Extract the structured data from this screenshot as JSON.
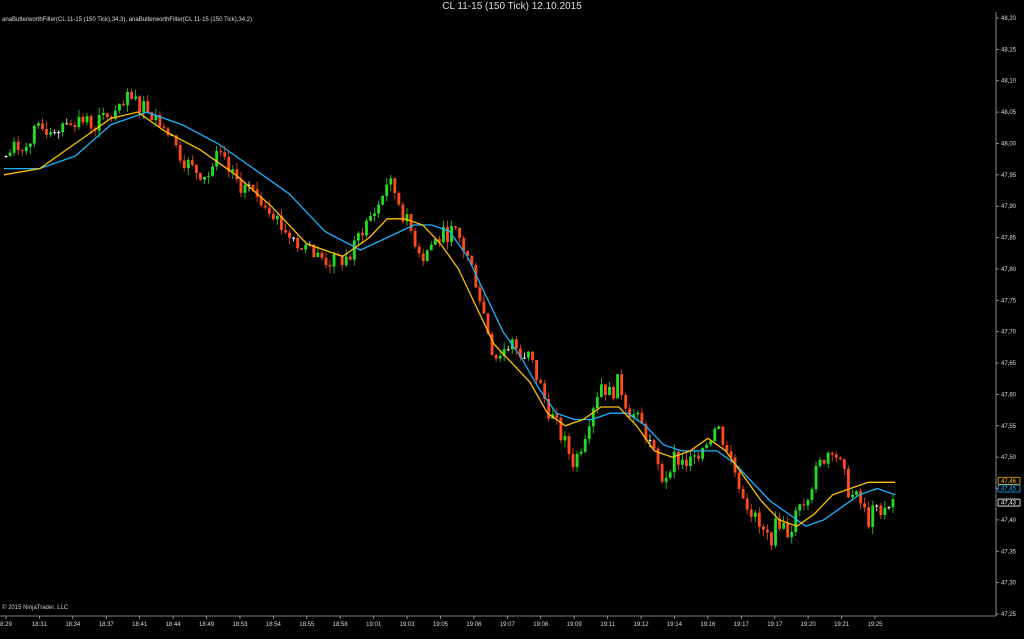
{
  "window": {
    "title": "CL 11-15 (150 Tick)  12.10.2015",
    "indicator_label": "anaButterworthFilter(CL 11-15 (150 Tick),34,3), anaButterworthFilter(CL 11-15 (150 Tick),34,2)",
    "copyright": "© 2015 NinjaTrader, LLC"
  },
  "colors": {
    "background": "#000000",
    "up_candle": "#22dd22",
    "down_candle": "#ff4a1a",
    "doji": "#ffffff",
    "filter_3pole": "#1ab2ff",
    "filter_2pole": "#ffc000",
    "axis": "#aaaaaa"
  },
  "chart_data": {
    "type": "candlestick",
    "ylim": [
      47.25,
      48.2
    ],
    "y_ticks": [
      "48,20",
      "48,15",
      "48,10",
      "48,05",
      "48,00",
      "47,95",
      "47,90",
      "47,85",
      "47,80",
      "47,75",
      "47,70",
      "47,65",
      "47,60",
      "47,55",
      "47,50",
      "47,45",
      "47,40",
      "47,35",
      "47,30",
      "47,25"
    ],
    "x_ticks": [
      "8:29",
      "18:31",
      "18:34",
      "18:37",
      "18:41",
      "18:44",
      "18:49",
      "18:53",
      "18:54",
      "18:55",
      "18:58",
      "19:01",
      "19:03",
      "19:05",
      "19:06",
      "19:07",
      "19:08",
      "19:09",
      "19:11",
      "19:12",
      "19:14",
      "19:16",
      "19:17",
      "19:17",
      "19:20",
      "19:21",
      "19:25"
    ],
    "price_badges": [
      {
        "label": "47,46",
        "value": 47.46,
        "color": "#ffc000"
      },
      {
        "label": "47,45",
        "value": 47.45,
        "color": "#1ab2ff"
      },
      {
        "label": "47,43",
        "value": 47.43,
        "color": "#ffffff"
      }
    ],
    "close_path": [
      [
        0,
        47.98
      ],
      [
        4,
        48.02
      ],
      [
        8,
        48.04
      ],
      [
        10,
        48.03
      ],
      [
        13,
        48.05
      ],
      [
        14,
        48.07
      ],
      [
        16,
        48.06
      ],
      [
        18,
        48.03
      ],
      [
        19,
        48.0
      ],
      [
        21,
        47.96
      ],
      [
        23,
        47.95
      ],
      [
        24,
        47.98
      ],
      [
        26,
        47.94
      ],
      [
        28,
        47.92
      ],
      [
        30,
        47.9
      ],
      [
        31,
        47.87
      ],
      [
        33,
        47.84
      ],
      [
        35,
        47.82
      ],
      [
        37,
        47.81
      ],
      [
        39,
        47.82
      ],
      [
        40,
        47.86
      ],
      [
        42,
        47.9
      ],
      [
        43,
        47.94
      ],
      [
        44,
        47.92
      ],
      [
        45,
        47.88
      ],
      [
        46,
        47.85
      ],
      [
        47,
        47.82
      ],
      [
        48,
        47.84
      ],
      [
        50,
        47.86
      ],
      [
        51,
        47.85
      ],
      [
        52,
        47.82
      ],
      [
        53,
        47.78
      ],
      [
        54,
        47.72
      ],
      [
        55,
        47.66
      ],
      [
        56,
        47.67
      ],
      [
        57,
        47.68
      ],
      [
        59,
        47.66
      ],
      [
        60,
        47.62
      ],
      [
        61,
        47.58
      ],
      [
        62,
        47.55
      ],
      [
        63,
        47.52
      ],
      [
        64,
        47.49
      ],
      [
        65,
        47.53
      ],
      [
        66,
        47.58
      ],
      [
        67,
        47.62
      ],
      [
        68,
        47.6
      ],
      [
        69,
        47.62
      ],
      [
        70,
        47.58
      ],
      [
        71,
        47.56
      ],
      [
        72,
        47.54
      ],
      [
        73,
        47.5
      ],
      [
        74,
        47.46
      ],
      [
        75,
        47.5
      ],
      [
        77,
        47.49
      ],
      [
        78,
        47.51
      ],
      [
        79,
        47.53
      ],
      [
        80,
        47.55
      ],
      [
        81,
        47.52
      ],
      [
        82,
        47.48
      ],
      [
        83,
        47.44
      ],
      [
        84,
        47.41
      ],
      [
        85,
        47.38
      ],
      [
        86,
        47.37
      ],
      [
        87,
        47.4
      ],
      [
        88,
        47.38
      ],
      [
        89,
        47.41
      ],
      [
        90,
        47.44
      ],
      [
        91,
        47.47
      ],
      [
        92,
        47.5
      ],
      [
        93,
        47.52
      ],
      [
        94,
        47.48
      ],
      [
        95,
        47.44
      ],
      [
        96,
        47.43
      ],
      [
        97,
        47.4
      ],
      [
        98,
        47.42
      ],
      [
        100,
        47.43
      ]
    ],
    "series": [
      {
        "name": "anaButterworthFilter(CL 11-15 (150 Tick),34,3)",
        "color": "#1ab2ff",
        "values": [
          [
            0,
            47.96
          ],
          [
            4,
            47.96
          ],
          [
            8,
            47.98
          ],
          [
            12,
            48.03
          ],
          [
            16,
            48.05
          ],
          [
            20,
            48.03
          ],
          [
            24,
            48.0
          ],
          [
            28,
            47.96
          ],
          [
            32,
            47.92
          ],
          [
            36,
            47.86
          ],
          [
            40,
            47.83
          ],
          [
            43,
            47.85
          ],
          [
            46,
            47.87
          ],
          [
            48,
            47.87
          ],
          [
            50,
            47.86
          ],
          [
            52,
            47.82
          ],
          [
            54,
            47.76
          ],
          [
            56,
            47.7
          ],
          [
            58,
            47.66
          ],
          [
            60,
            47.61
          ],
          [
            62,
            47.57
          ],
          [
            64,
            47.56
          ],
          [
            66,
            47.56
          ],
          [
            68,
            47.57
          ],
          [
            70,
            47.57
          ],
          [
            72,
            47.55
          ],
          [
            74,
            47.52
          ],
          [
            76,
            47.51
          ],
          [
            78,
            47.51
          ],
          [
            80,
            47.51
          ],
          [
            82,
            47.49
          ],
          [
            84,
            47.46
          ],
          [
            86,
            47.43
          ],
          [
            88,
            47.41
          ],
          [
            90,
            47.39
          ],
          [
            92,
            47.4
          ],
          [
            94,
            47.42
          ],
          [
            96,
            47.44
          ],
          [
            98,
            47.45
          ],
          [
            100,
            47.44
          ]
        ]
      },
      {
        "name": "anaButterworthFilter(CL 11-15 (150 Tick),34,2)",
        "color": "#ffc000",
        "values": [
          [
            0,
            47.95
          ],
          [
            4,
            47.96
          ],
          [
            8,
            48.0
          ],
          [
            12,
            48.04
          ],
          [
            15,
            48.05
          ],
          [
            18,
            48.02
          ],
          [
            22,
            47.99
          ],
          [
            26,
            47.95
          ],
          [
            30,
            47.9
          ],
          [
            34,
            47.84
          ],
          [
            38,
            47.82
          ],
          [
            41,
            47.85
          ],
          [
            43,
            47.88
          ],
          [
            45,
            47.88
          ],
          [
            47,
            47.87
          ],
          [
            49,
            47.84
          ],
          [
            51,
            47.8
          ],
          [
            53,
            47.74
          ],
          [
            55,
            47.68
          ],
          [
            57,
            47.65
          ],
          [
            59,
            47.62
          ],
          [
            61,
            47.57
          ],
          [
            63,
            47.55
          ],
          [
            65,
            47.56
          ],
          [
            67,
            47.58
          ],
          [
            69,
            47.58
          ],
          [
            71,
            47.55
          ],
          [
            73,
            47.51
          ],
          [
            75,
            47.5
          ],
          [
            77,
            47.51
          ],
          [
            79,
            47.53
          ],
          [
            81,
            47.51
          ],
          [
            83,
            47.47
          ],
          [
            85,
            47.43
          ],
          [
            87,
            47.4
          ],
          [
            89,
            47.39
          ],
          [
            91,
            47.41
          ],
          [
            93,
            47.44
          ],
          [
            95,
            47.45
          ],
          [
            97,
            47.46
          ],
          [
            100,
            47.46
          ]
        ]
      }
    ]
  }
}
